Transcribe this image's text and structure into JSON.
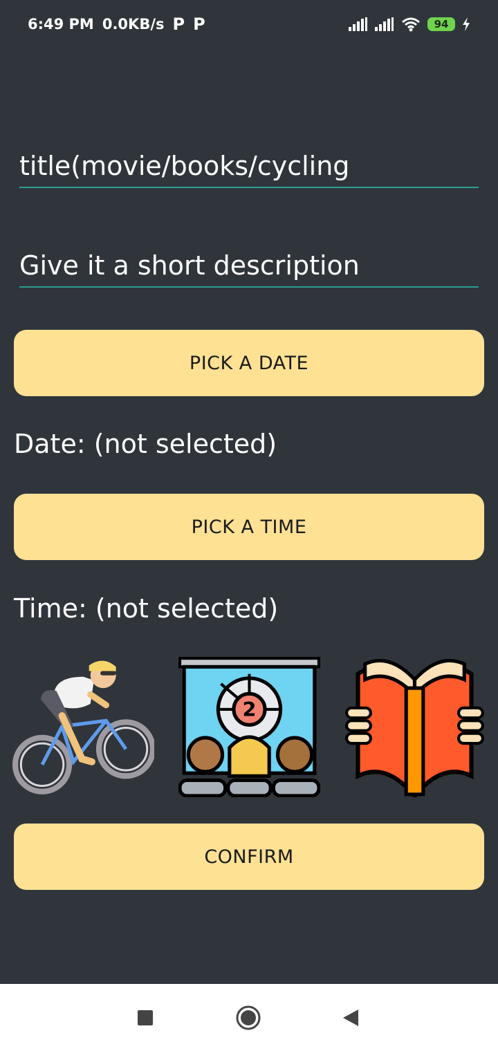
{
  "status_bar": {
    "time": "6:49 PM",
    "speed": "0.0KB/s",
    "p_icon_1": "P",
    "p_icon_2": "P",
    "battery": "94"
  },
  "form": {
    "title_value": "title(movie/books/cycling",
    "description_placeholder": "Give it a short description",
    "pick_date_label": "PICK A DATE",
    "date_text": "Date: (not selected)",
    "pick_time_label": "PICK A TIME",
    "time_text": "Time: (not selected)",
    "confirm_label": "CONFIRM"
  },
  "activities": [
    {
      "icon": "cycling-icon"
    },
    {
      "icon": "movie-icon"
    },
    {
      "icon": "book-icon"
    }
  ],
  "colors": {
    "background": "#2f353b",
    "button": "#ffe194",
    "field_underline": "#2a9d8f"
  }
}
